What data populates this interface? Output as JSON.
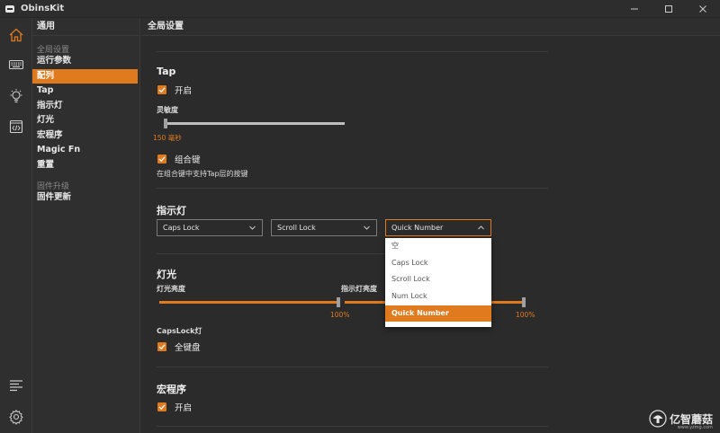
{
  "app": {
    "title": "ObinsKit"
  },
  "sidebar": {
    "header": "通用",
    "group_global": "全局设置",
    "items_global": [
      "运行参数",
      "配列",
      "Tap",
      "指示灯",
      "灯光",
      "宏程序",
      "Magic Fn",
      "重置"
    ],
    "active_index": 1,
    "group_firmware": "固件升级",
    "items_firmware": [
      "固件更新"
    ]
  },
  "content": {
    "header": "全局设置",
    "tap": {
      "title": "Tap",
      "enable_label": "开启",
      "sensitivity_label": "灵敏度",
      "sensitivity_value": "150 毫秒",
      "sensitivity_fraction": 0.0,
      "combo_label": "组合键",
      "combo_hint": "在组合键中支持Tap层的按键"
    },
    "indicator": {
      "title": "指示灯",
      "select1": "Caps Lock",
      "select2": "Scroll Lock",
      "select3": "Quick Number",
      "options": [
        "空",
        "Caps Lock",
        "Scroll Lock",
        "Num Lock",
        "Quick Number"
      ],
      "selected_option_index": 4
    },
    "lighting": {
      "title": "灯光",
      "brightness_label": "灯光亮度",
      "brightness_value": "100%",
      "brightness_fraction": 1.0,
      "indicator_brightness_label": "指示灯亮度",
      "indicator_brightness_value": "100%",
      "indicator_brightness_fraction": 1.0,
      "capslock_label": "CapsLock灯",
      "full_keyboard_label": "全键盘"
    },
    "macro": {
      "title": "宏程序",
      "enable_label": "开启"
    }
  },
  "watermark": {
    "text": "亿智蘑菇",
    "url": "www.yzmg.com"
  },
  "colors": {
    "accent": "#e07a1f",
    "background": "#2b2b2b",
    "panel": "#2f2f2f"
  }
}
